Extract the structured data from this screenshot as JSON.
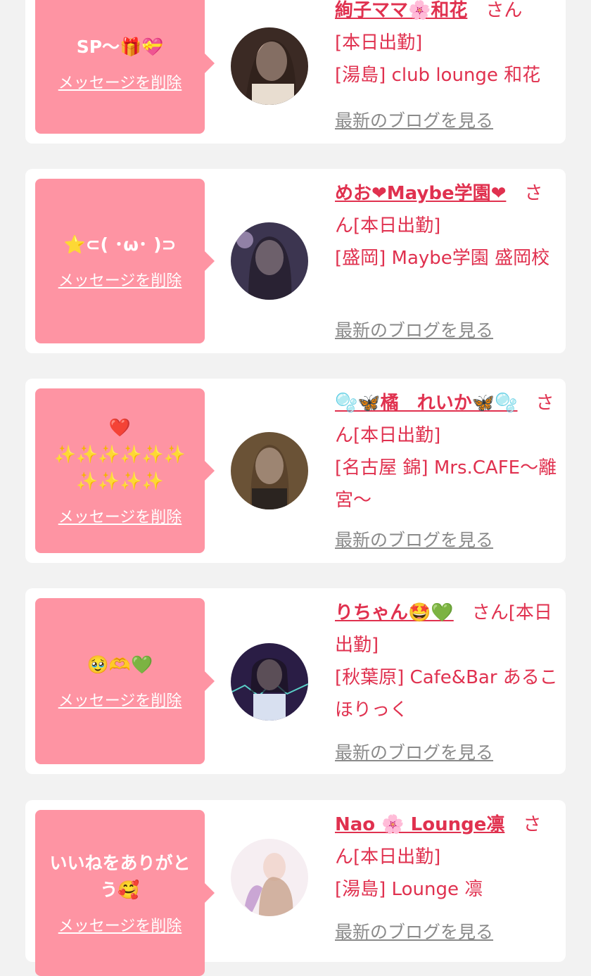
{
  "cards": [
    {
      "message": "SP〜🎁💝",
      "delete_label": "メッセージを削除",
      "name": "絢子ママ🌸和花",
      "suffix": "さん",
      "status": "[本日出勤]",
      "location": "[湯島] club lounge 和花",
      "blog_label": "最新のブログを見る"
    },
    {
      "message": "⭐️⊂( ･ω･ )⊃",
      "delete_label": "メッセージを削除",
      "name": "めお❤Maybe学園❤",
      "suffix": "さん",
      "status": "[本日出勤]",
      "location": "[盛岡] Maybe学園 盛岡校",
      "blog_label": "最新のブログを見る"
    },
    {
      "message": "❤️\n✨✨✨✨✨✨\n✨✨✨✨",
      "delete_label": "メッセージを削除",
      "name": "🫧🦋橘　れいか🦋🫧",
      "suffix": "さん",
      "status": "[本日出勤]",
      "location": "[名古屋 錦] Mrs.CAFE〜離宮〜",
      "blog_label": "最新のブログを見る"
    },
    {
      "message": "🥹🫶💚",
      "delete_label": "メッセージを削除",
      "name": "りちゃん🤩💚",
      "suffix": "さん",
      "status": "[本日出勤]",
      "location": "[秋葉原] Cafe&Bar あるこほりっく",
      "blog_label": "最新のブログを見る"
    },
    {
      "message": "いいねをありがとう🥰",
      "delete_label": "メッセージを削除",
      "name": "Nao 🌸 Lounge凛",
      "suffix": "さん",
      "status": "[本日出勤]",
      "location": "[湯島] Lounge 凛",
      "blog_label": "最新のブログを見る"
    }
  ],
  "colors": {
    "bubble": "#fe94a3",
    "name": "#e0314f",
    "link_gray": "#8a8a8a",
    "background": "#f2f2f2"
  }
}
